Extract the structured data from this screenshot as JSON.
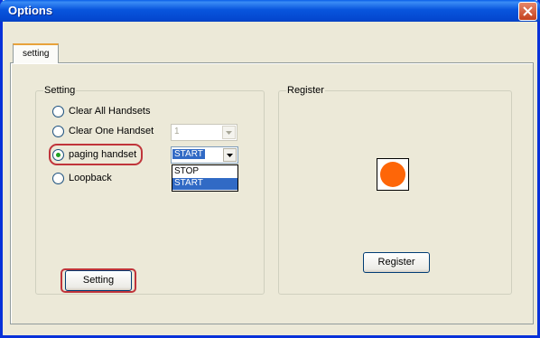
{
  "window": {
    "title": "Options"
  },
  "tabs": [
    {
      "label": "setting"
    }
  ],
  "setting_group": {
    "title": "Setting",
    "options": [
      {
        "label": "Clear All Handsets",
        "checked": false
      },
      {
        "label": "Clear One Handset",
        "checked": false
      },
      {
        "label": "paging handset",
        "checked": true
      },
      {
        "label": "Loopback",
        "checked": false
      }
    ],
    "handset_combo": {
      "value": "1",
      "enabled": false
    },
    "paging_combo": {
      "value": "START",
      "options": [
        "STOP",
        "START"
      ],
      "selected": "START"
    },
    "setting_button": "Setting"
  },
  "register_group": {
    "title": "Register",
    "indicator_color": "#fe6608",
    "register_button": "Register"
  },
  "colors": {
    "highlight": "#c0343a",
    "selection": "#316ac5",
    "title_bar": "#0855dd"
  }
}
